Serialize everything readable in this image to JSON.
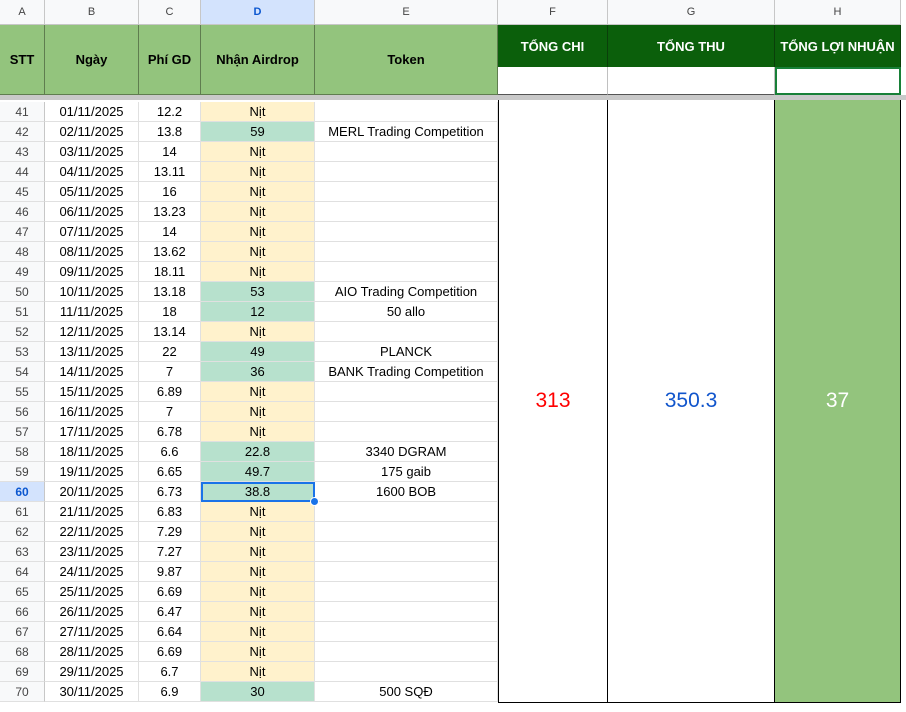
{
  "columns": [
    "A",
    "B",
    "C",
    "D",
    "E",
    "F",
    "G",
    "H"
  ],
  "selected_column": "D",
  "headers": {
    "stt": "STT",
    "ngay": "Ngày",
    "phi": "Phí GD",
    "nhan": "Nhận Airdrop",
    "token": "Token",
    "tong_chi": "TỔNG CHI",
    "tong_thu": "TỔNG THU",
    "tong_loi_nhuan": "TỔNG LỢI NHUẬN"
  },
  "totals": {
    "tong_chi": "313",
    "tong_thu": "350.3",
    "tong_loi_nhuan": "37"
  },
  "colors": {
    "tong_chi": "#ff0000",
    "tong_thu": "#1155cc",
    "tong_loi_nhuan": "#ffffff",
    "header_green": "#0b5f0b",
    "header_light": "#93c47d",
    "nit_fill": "#fff2cc",
    "airdrop_fill": "#b7e1cd"
  },
  "selected_row": "60",
  "rows": [
    {
      "rn": "41",
      "stt": "41",
      "date": "01/11/2025",
      "fee": "12.2",
      "airdrop": "Nịt",
      "token": ""
    },
    {
      "rn": "42",
      "stt": "42",
      "date": "02/11/2025",
      "fee": "13.8",
      "airdrop": "59",
      "token": "MERL Trading Competition"
    },
    {
      "rn": "43",
      "stt": "43",
      "date": "03/11/2025",
      "fee": "14",
      "airdrop": "Nịt",
      "token": ""
    },
    {
      "rn": "44",
      "stt": "44",
      "date": "04/11/2025",
      "fee": "13.11",
      "airdrop": "Nịt",
      "token": ""
    },
    {
      "rn": "45",
      "stt": "45",
      "date": "05/11/2025",
      "fee": "16",
      "airdrop": "Nịt",
      "token": ""
    },
    {
      "rn": "46",
      "stt": "46",
      "date": "06/11/2025",
      "fee": "13.23",
      "airdrop": "Nịt",
      "token": ""
    },
    {
      "rn": "47",
      "stt": "47",
      "date": "07/11/2025",
      "fee": "14",
      "airdrop": "Nịt",
      "token": ""
    },
    {
      "rn": "48",
      "stt": "48",
      "date": "08/11/2025",
      "fee": "13.62",
      "airdrop": "Nịt",
      "token": ""
    },
    {
      "rn": "49",
      "stt": "49",
      "date": "09/11/2025",
      "fee": "18.11",
      "airdrop": "Nịt",
      "token": ""
    },
    {
      "rn": "50",
      "stt": "50",
      "date": "10/11/2025",
      "fee": "13.18",
      "airdrop": "53",
      "token": "AIO Trading Competition"
    },
    {
      "rn": "51",
      "stt": "51",
      "date": "11/11/2025",
      "fee": "18",
      "airdrop": "12",
      "token": "50 allo"
    },
    {
      "rn": "52",
      "stt": "52",
      "date": "12/11/2025",
      "fee": "13.14",
      "airdrop": "Nịt",
      "token": ""
    },
    {
      "rn": "53",
      "stt": "53",
      "date": "13/11/2025",
      "fee": "22",
      "airdrop": "49",
      "token": "PLANCK"
    },
    {
      "rn": "54",
      "stt": "54",
      "date": "14/11/2025",
      "fee": "7",
      "airdrop": "36",
      "token": "BANK Trading Competition"
    },
    {
      "rn": "55",
      "stt": "55",
      "date": "15/11/2025",
      "fee": "6.89",
      "airdrop": "Nịt",
      "token": ""
    },
    {
      "rn": "56",
      "stt": "56",
      "date": "16/11/2025",
      "fee": "7",
      "airdrop": "Nịt",
      "token": ""
    },
    {
      "rn": "57",
      "stt": "57",
      "date": "17/11/2025",
      "fee": "6.78",
      "airdrop": "Nịt",
      "token": ""
    },
    {
      "rn": "58",
      "stt": "58",
      "date": "18/11/2025",
      "fee": "6.6",
      "airdrop": "22.8",
      "token": "3340 DGRAM"
    },
    {
      "rn": "59",
      "stt": "59",
      "date": "19/11/2025",
      "fee": "6.65",
      "airdrop": "49.7",
      "token": "175 gaib"
    },
    {
      "rn": "60",
      "stt": "60",
      "date": "20/11/2025",
      "fee": "6.73",
      "airdrop": "38.8",
      "token": "1600 BOB"
    },
    {
      "rn": "61",
      "stt": "61",
      "date": "21/11/2025",
      "fee": "6.83",
      "airdrop": "Nịt",
      "token": ""
    },
    {
      "rn": "62",
      "stt": "62",
      "date": "22/11/2025",
      "fee": "7.29",
      "airdrop": "Nịt",
      "token": ""
    },
    {
      "rn": "63",
      "stt": "63",
      "date": "23/11/2025",
      "fee": "7.27",
      "airdrop": "Nịt",
      "token": ""
    },
    {
      "rn": "64",
      "stt": "64",
      "date": "24/11/2025",
      "fee": "9.87",
      "airdrop": "Nịt",
      "token": ""
    },
    {
      "rn": "65",
      "stt": "65",
      "date": "25/11/2025",
      "fee": "6.69",
      "airdrop": "Nịt",
      "token": ""
    },
    {
      "rn": "66",
      "stt": "66",
      "date": "26/11/2025",
      "fee": "6.47",
      "airdrop": "Nịt",
      "token": ""
    },
    {
      "rn": "67",
      "stt": "67",
      "date": "27/11/2025",
      "fee": "6.64",
      "airdrop": "Nịt",
      "token": ""
    },
    {
      "rn": "68",
      "stt": "68",
      "date": "28/11/2025",
      "fee": "6.69",
      "airdrop": "Nịt",
      "token": ""
    },
    {
      "rn": "69",
      "stt": "69",
      "date": "29/11/2025",
      "fee": "6.7",
      "airdrop": "Nịt",
      "token": ""
    },
    {
      "rn": "70",
      "stt": "70",
      "date": "30/11/2025",
      "fee": "6.9",
      "airdrop": "30",
      "token": "500 SQĐ"
    }
  ]
}
